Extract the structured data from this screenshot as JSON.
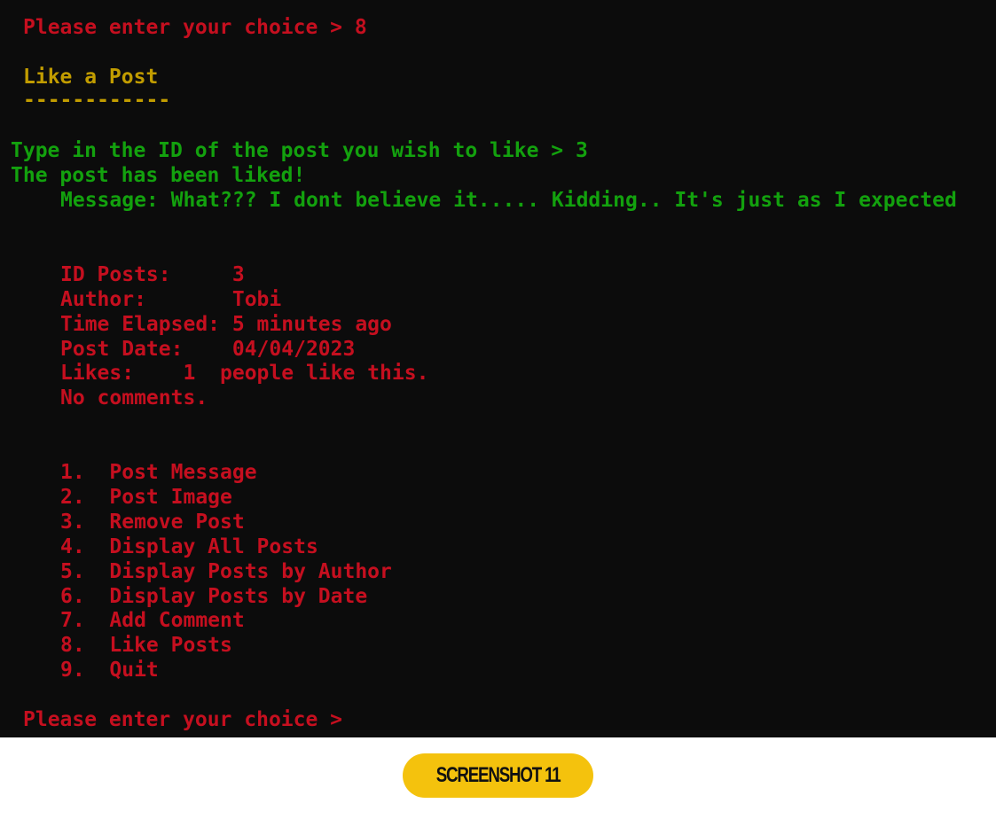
{
  "colors": {
    "terminal_bg": "#0c0c0c",
    "red_text": "#c50f1f",
    "green_text": "#13a10e",
    "yellow_text": "#c19c00",
    "badge_bg": "#f4c20d"
  },
  "terminal": {
    "prompt_top": "Please enter your choice > 8",
    "section_title": "Like a Post",
    "section_underline": "------------",
    "id_prompt": "Type in the ID of the post you wish to like > 3",
    "liked_confirmation": "The post has been liked!",
    "message_line": "Message: What??? I dont believe it..... Kidding.. It's just as I expected",
    "post": {
      "id_line": "ID Posts:     3",
      "author_line": "Author:       Tobi",
      "time_line": "Time Elapsed: 5 minutes ago",
      "date_line": "Post Date:    04/04/2023",
      "likes_line": "Likes:    1  people like this.",
      "comments_line": "No comments."
    },
    "menu": [
      "1.  Post Message",
      "2.  Post Image",
      "3.  Remove Post",
      "4.  Display All Posts",
      "5.  Display Posts by Author",
      "6.  Display Posts by Date",
      "7.  Add Comment",
      "8.  Like Posts",
      "9.  Quit"
    ],
    "prompt_bottom": "Please enter your choice >"
  },
  "footer": {
    "badge_label": "SCREENSHOT 11"
  }
}
